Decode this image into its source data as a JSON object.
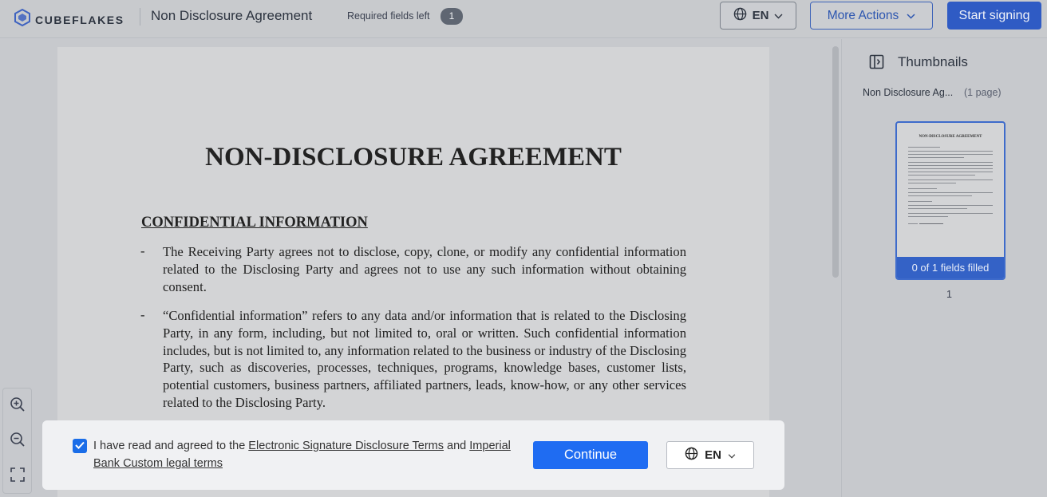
{
  "header": {
    "brand": "CUBEFLAKES",
    "doc_title": "Non Disclosure Agreement",
    "required_label": "Required fields left",
    "required_count": "1",
    "lang": "EN",
    "more_actions": "More Actions",
    "start_signing": "Start signing"
  },
  "document": {
    "title": "NON-DISCLOSURE AGREEMENT",
    "section_heading": "CONFIDENTIAL INFORMATION",
    "bullet_marker": "-",
    "paragraphs": [
      "The Receiving Party agrees not to disclose, copy, clone, or modify any confidential information related to the Disclosing Party and agrees not to use any such information without obtaining consent.",
      "“Confidential information” refers to any data and/or information that is related to the Disclosing Party, in any form, including, but not limited to, oral or written. Such confidential information includes, but is not limited to, any information related to the business or industry of the Disclosing Party, such as discoveries, processes, techniques, programs, knowledge bases, customer lists, potential customers, business partners, affiliated partners, leads, know-how, or any other services related to the Disclosing Party."
    ]
  },
  "thumbnails": {
    "title": "Thumbnails",
    "doc_name": "Non Disclosure Ag...",
    "page_count": "(1 page)",
    "mini_title": "NON-DISCLOSURE AGREEMENT",
    "status": "0 of 1 fields filled",
    "page_number": "1"
  },
  "consent": {
    "text_prefix": "I have read and agreed to the",
    "link1": "Electronic Signature Disclosure Terms",
    "conjunction": "and",
    "link2": "Imperial Bank Custom legal terms",
    "continue": "Continue",
    "lang": "EN"
  },
  "icons": {
    "logo": "cube-logo-icon",
    "globe": "globe-icon",
    "chevron": "chevron-down-icon",
    "zoom_in": "zoom-in-icon",
    "zoom_out": "zoom-out-icon",
    "fit": "fit-screen-icon",
    "panel": "panel-toggle-icon",
    "check": "check-icon"
  },
  "colors": {
    "primary": "#1f6cf2",
    "header_primary": "#2f5bc4",
    "badge": "#5f6672"
  }
}
